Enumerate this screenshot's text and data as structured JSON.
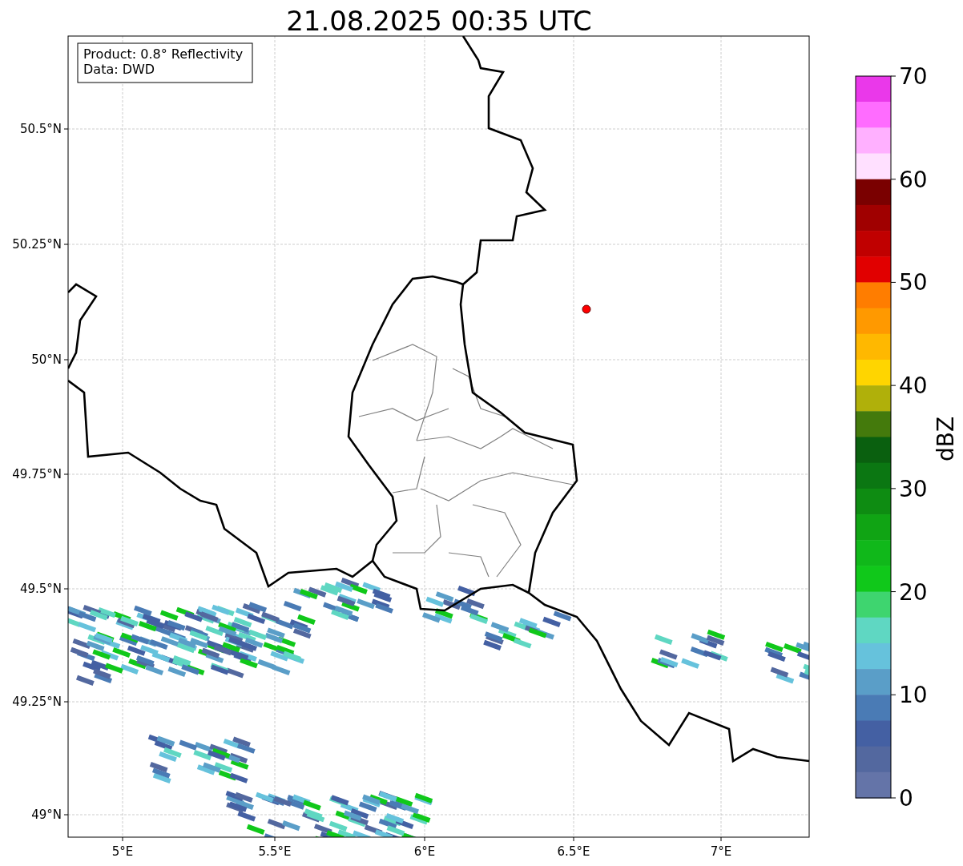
{
  "title": "21.08.2025 00:35 UTC",
  "info_box": {
    "lines": [
      "Product: 0.8° Reflectivity",
      "Data: DWD"
    ]
  },
  "map": {
    "x_ticks": [
      "5°E",
      "5.5°E",
      "6°E",
      "6.5°E",
      "7°E"
    ],
    "y_ticks": [
      "50.5°N",
      "50.25°N",
      "50°N",
      "49.75°N",
      "49.5°N",
      "49.25°N",
      "49°N"
    ]
  },
  "colorbar": {
    "label": "dBZ",
    "ticks": [
      "70",
      "60",
      "50",
      "40",
      "30",
      "20",
      "10",
      "0"
    ],
    "bands": [
      {
        "color": "#ea38ea"
      },
      {
        "color": "#ff6cff"
      },
      {
        "color": "#ffb0ff"
      },
      {
        "color": "#ffe0ff"
      },
      {
        "color": "#7a0000"
      },
      {
        "color": "#a00000"
      },
      {
        "color": "#c00000"
      },
      {
        "color": "#e10000"
      },
      {
        "color": "#ff7d00"
      },
      {
        "color": "#ff9900"
      },
      {
        "color": "#ffb800"
      },
      {
        "color": "#ffd500"
      },
      {
        "color": "#b0b00a"
      },
      {
        "color": "#447a0c"
      },
      {
        "color": "#0a600f"
      },
      {
        "color": "#0b7712"
      },
      {
        "color": "#0e8c12"
      },
      {
        "color": "#10a414"
      },
      {
        "color": "#10b81a"
      },
      {
        "color": "#10c81a"
      },
      {
        "color": "#3ed56f"
      },
      {
        "color": "#5fd7c2"
      },
      {
        "color": "#66c2dc"
      },
      {
        "color": "#5a9ec8"
      },
      {
        "color": "#4a7bb5"
      },
      {
        "color": "#4460a3"
      },
      {
        "color": "#53689f"
      },
      {
        "color": "#6474a8"
      }
    ]
  }
}
